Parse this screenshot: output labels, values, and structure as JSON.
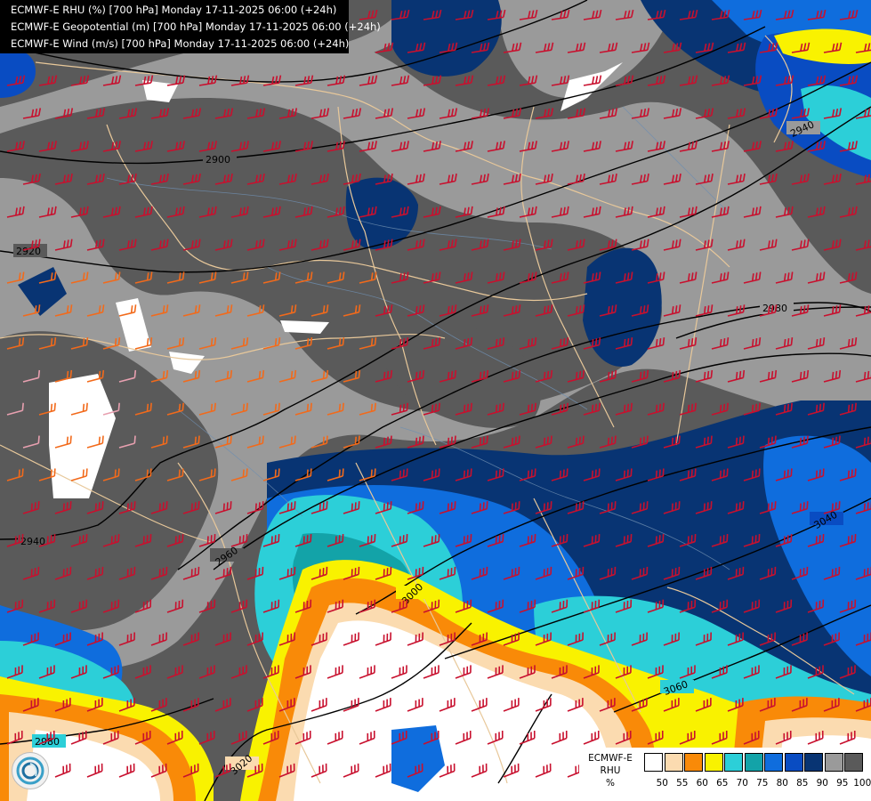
{
  "header": {
    "line1": "ECMWF-E RHU (%) [700 hPa] Monday 17-11-2025 06:00 (+24h)",
    "line2": "ECMWF-E Geopotential (m) [700 hPa] Monday 17-11-2025 06:00 (+24h)",
    "line3": "ECMWF-E Wind (m/s) [700 hPa] Monday 17-11-2025 06:00 (+24h)"
  },
  "legend": {
    "title_line1": "ECMWF-E",
    "title_line2": "RHU",
    "title_line3": "%",
    "swatch_colors": [
      "#ffffff",
      "#fbdbb0",
      "#f98a08",
      "#f9f200",
      "#2ccfd8",
      "#13a3a8",
      "#0f6ddd",
      "#094cc2",
      "#083473",
      "#9a9a9a",
      "#5a5a5a"
    ],
    "tick_labels": [
      "50",
      "55",
      "60",
      "65",
      "70",
      "75",
      "80",
      "85",
      "90",
      "95",
      "100"
    ]
  },
  "contours": [
    {
      "label": "2900"
    },
    {
      "label": "2920"
    },
    {
      "label": "2940"
    },
    {
      "label": "2960"
    },
    {
      "label": "2980"
    },
    {
      "label": "2980"
    },
    {
      "label": "3000"
    },
    {
      "label": "3020"
    },
    {
      "label": "3040"
    },
    {
      "label": "3060"
    },
    {
      "label": "2940"
    }
  ],
  "colors": {
    "wind_barb_strong": "#c8102e",
    "wind_barb_moderate": "#f26a1b",
    "wind_barb_weak": "#e8a0b0",
    "border_line": "#e8c89a"
  }
}
